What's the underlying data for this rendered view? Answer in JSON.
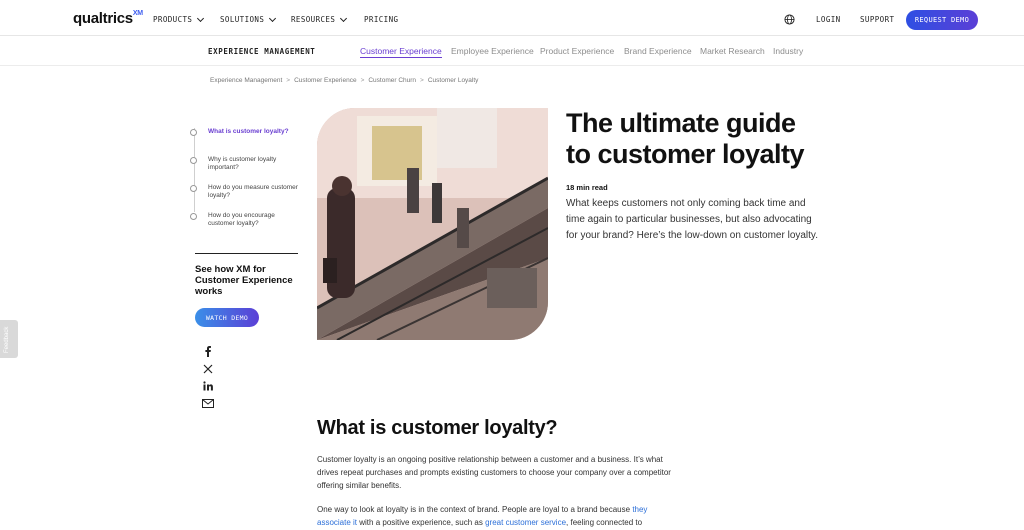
{
  "header": {
    "logo": "qualtrics",
    "logo_sup": "XM",
    "nav": [
      {
        "label": "PRODUCTS",
        "dropdown": true
      },
      {
        "label": "SOLUTIONS",
        "dropdown": true
      },
      {
        "label": "RESOURCES",
        "dropdown": true
      },
      {
        "label": "PRICING",
        "dropdown": false
      }
    ],
    "login": "LOGIN",
    "support": "SUPPORT",
    "request_demo": "REQUEST DEMO",
    "globe_icon": "globe-icon"
  },
  "subnav": {
    "title": "EXPERIENCE MANAGEMENT",
    "links": [
      "Customer Experience",
      "Employee Experience",
      "Product Experience",
      "Brand Experience",
      "Market Research",
      "Industry"
    ],
    "active": "Customer Experience"
  },
  "breadcrumb": [
    "Experience Management",
    "Customer Experience",
    "Customer Churn",
    "Customer Loyalty"
  ],
  "toc": {
    "items": [
      "What is customer loyalty?",
      "Why is customer loyalty important?",
      "How do you measure customer loyalty?",
      "How do you encourage customer loyalty?"
    ],
    "active_index": 0
  },
  "sidebar": {
    "see_how": "See how XM for Customer Experience works",
    "watch_demo": "WATCH DEMO",
    "social_icons": [
      "facebook-icon",
      "x-icon",
      "linkedin-icon",
      "email-icon"
    ]
  },
  "feedback": "Feedback",
  "article": {
    "title": "The ultimate guide to customer loyalty",
    "read_time": "18 min read",
    "intro": "What keeps customers not only coming back time and time again to particular businesses, but also advocating for your brand? Here’s the low-down on customer loyalty.",
    "section_title": "What is customer loyalty?",
    "para1": "Customer loyalty is an ongoing positive relationship between a customer and a business. It’s what drives repeat purchases and prompts existing customers to choose your company over a competitor offering similar benefits.",
    "para2_a": "One way to look at loyalty is in the context of brand. People are loyal to a brand because ",
    "para2_link1": "they associate it",
    "para2_b": " with a positive experience, such as ",
    "para2_link2": "great customer service",
    "para2_c": ", feeling connected to"
  },
  "colors": {
    "accent": "#6a3fd1",
    "brand_blue": "#2e4fe3",
    "link": "#2c6fd8"
  }
}
